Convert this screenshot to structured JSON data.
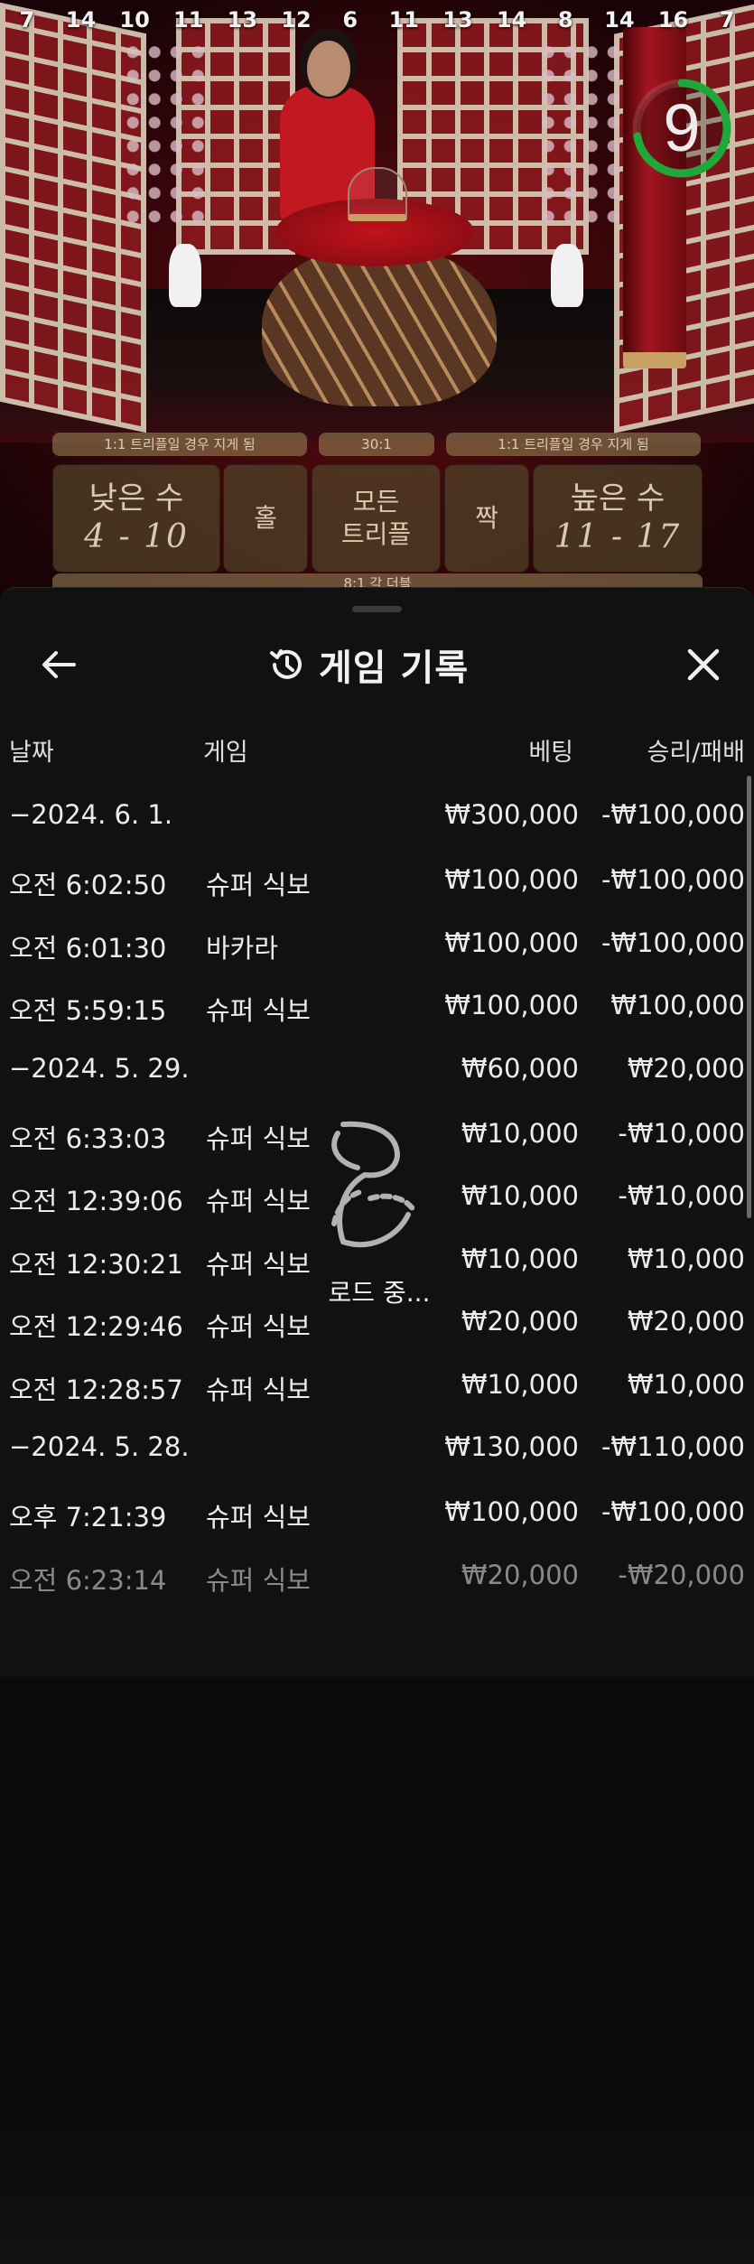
{
  "top_numbers": [
    "7",
    "14",
    "10",
    "11",
    "13",
    "12",
    "6",
    "11",
    "13",
    "14",
    "8",
    "14",
    "16",
    "7"
  ],
  "timer": {
    "value": "9",
    "progress": 0.72,
    "color": "#1fa83a"
  },
  "board": {
    "pill_left": "1:1 트리플일 경우 지게 됨",
    "pill_mid": "30:1",
    "pill_right": "1:1 트리플일 경우 지게 됨",
    "low_label": "낮은 수",
    "low_range": "4 - 10",
    "odd_label": "홀",
    "triple_line1": "모든",
    "triple_line2": "트리플",
    "even_label": "짝",
    "high_label": "높은 수",
    "high_range": "11 - 17",
    "bottom_pill": "8:1 각 더블"
  },
  "history": {
    "title": "게임 기록",
    "columns": {
      "date": "날짜",
      "game": "게임",
      "bet": "베팅",
      "result": "승리/패배"
    },
    "rows": [
      {
        "type": "date",
        "date": "−2024. 6. 1.",
        "game": "",
        "bet": "₩300,000",
        "result": "-₩100,000"
      },
      {
        "type": "item",
        "date": "오전 6:02:50",
        "game": "슈퍼 식보",
        "bet": "₩100,000",
        "result": "-₩100,000"
      },
      {
        "type": "item",
        "date": "오전 6:01:30",
        "game": "바카라",
        "bet": "₩100,000",
        "result": "-₩100,000"
      },
      {
        "type": "item",
        "date": "오전 5:59:15",
        "game": "슈퍼 식보",
        "bet": "₩100,000",
        "result": "₩100,000"
      },
      {
        "type": "date",
        "date": "−2024. 5. 29.",
        "game": "",
        "bet": "₩60,000",
        "result": "₩20,000"
      },
      {
        "type": "item",
        "date": "오전 6:33:03",
        "game": "슈퍼 식보",
        "bet": "₩10,000",
        "result": "-₩10,000"
      },
      {
        "type": "item",
        "date": "오전 12:39:06",
        "game": "슈퍼 식보",
        "bet": "₩10,000",
        "result": "-₩10,000"
      },
      {
        "type": "item",
        "date": "오전 12:30:21",
        "game": "슈퍼 식보",
        "bet": "₩10,000",
        "result": "₩10,000"
      },
      {
        "type": "item",
        "date": "오전 12:29:46",
        "game": "슈퍼 식보",
        "bet": "₩20,000",
        "result": "₩20,000"
      },
      {
        "type": "item",
        "date": "오전 12:28:57",
        "game": "슈퍼 식보",
        "bet": "₩10,000",
        "result": "₩10,000"
      },
      {
        "type": "date",
        "date": "−2024. 5. 28.",
        "game": "",
        "bet": "₩130,000",
        "result": "-₩110,000"
      },
      {
        "type": "item",
        "date": "오후 7:21:39",
        "game": "슈퍼 식보",
        "bet": "₩100,000",
        "result": "-₩100,000"
      },
      {
        "type": "item",
        "date": "오전 6:23:14",
        "game": "슈퍼 식보",
        "bet": "₩20,000",
        "result": "-₩20,000",
        "faded": true
      }
    ],
    "loading_text": "로드 중..."
  },
  "icons": {
    "back": "arrow-left-icon",
    "history": "history-icon",
    "close": "close-icon",
    "loader": "loading-spinner-icon"
  }
}
